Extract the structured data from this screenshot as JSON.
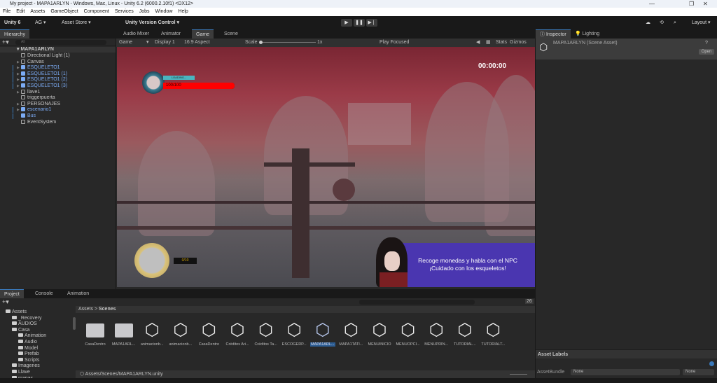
{
  "window": {
    "title": "My project - MAPA1ARLYN - Windows, Mac, Linux - Unity 6.2 (6000.2.10f1) <DX12>",
    "minimize": "—",
    "maximize": "❐",
    "close": "✕"
  },
  "menu": [
    "File",
    "Edit",
    "Assets",
    "GameObject",
    "Component",
    "Services",
    "Jobs",
    "Window",
    "Help"
  ],
  "toolbar": {
    "unity": "Unity 6",
    "account": "AG ▾",
    "asset_store": "Asset Store ▾",
    "version_control": "Unity Version Control ▾",
    "play": "▶",
    "pause": "❚❚",
    "step": "▶❘",
    "layout": "Layout ▾"
  },
  "hierarchy": {
    "tab": "Hierarchy",
    "search_placeholder": "All",
    "scene": "MAPA1ARLYN",
    "items": [
      {
        "label": "Directional Light (1)",
        "blue": false,
        "arrow": false
      },
      {
        "label": "Canvas",
        "blue": false,
        "arrow": true
      },
      {
        "label": "ESQUELETO1",
        "blue": true,
        "arrow": true
      },
      {
        "label": "ESQUELETO1 (1)",
        "blue": true,
        "arrow": true
      },
      {
        "label": "ESQUELETO1 (2)",
        "blue": true,
        "arrow": true
      },
      {
        "label": "ESQUELETO1 (3)",
        "blue": true,
        "arrow": true
      },
      {
        "label": "llave1",
        "blue": false,
        "arrow": true
      },
      {
        "label": "triggerpuerta",
        "blue": false,
        "arrow": false
      },
      {
        "label": "PERSONAJES",
        "blue": false,
        "arrow": true
      },
      {
        "label": "escenario1",
        "blue": true,
        "arrow": true
      },
      {
        "label": "Bus",
        "blue": true,
        "arrow": false
      },
      {
        "label": "EventSystem",
        "blue": false,
        "arrow": false
      }
    ]
  },
  "center_tabs": [
    "Audio Mixer",
    "Animator",
    "Game",
    "Scene"
  ],
  "game_toolbar": {
    "view": "Game",
    "display": "Display 1",
    "aspect": "16:9 Aspect",
    "scale_label": "Scale",
    "scale_value": "1x",
    "play_mode": "Play Focused",
    "stats": "Stats",
    "gizmos": "Gizmos"
  },
  "game": {
    "timer": "00:00:00",
    "health_label": "LOADING...",
    "health": "100/100",
    "health_fraction": 1.0,
    "coins": "0/10",
    "dialog_line1": "Recoge monedas y habla con el NPC",
    "dialog_line2": "¡Cuidado con los esqueletos!",
    "colors": {
      "health": "#ff0000",
      "dialog": "#4a36b0"
    }
  },
  "inspector": {
    "tabs": [
      "Inspector",
      "Lighting"
    ],
    "asset": "MAPA1ARLYN (Scene Asset)",
    "open": "Open",
    "labels": "Asset Labels",
    "bundle_label": "AssetBundle",
    "bundle": "None",
    "variant": "None"
  },
  "project": {
    "tabs": [
      "Project",
      "Console",
      "Animation"
    ],
    "tree": [
      {
        "label": "Assets",
        "indent": 0
      },
      {
        "label": "_Recovery",
        "indent": 1
      },
      {
        "label": "AUDIOS",
        "indent": 1
      },
      {
        "label": "Casa",
        "indent": 1
      },
      {
        "label": "Animation",
        "indent": 2
      },
      {
        "label": "Audio",
        "indent": 2
      },
      {
        "label": "Model",
        "indent": 2
      },
      {
        "label": "Prefab",
        "indent": 2
      },
      {
        "label": "Scripts",
        "indent": 2
      },
      {
        "label": "Imagenes",
        "indent": 1
      },
      {
        "label": "Llave",
        "indent": 1
      },
      {
        "label": "mapas",
        "indent": 1
      }
    ],
    "breadcrumb": [
      "Assets",
      "Scenes"
    ],
    "count": "26",
    "assets": [
      {
        "label": "CasaDentro",
        "type": "folder"
      },
      {
        "label": "MAPA1ARL...",
        "type": "folder"
      },
      {
        "label": "animacionb...",
        "type": "scene"
      },
      {
        "label": "animacionb...",
        "type": "scene"
      },
      {
        "label": "CasaDentro",
        "type": "scene"
      },
      {
        "label": "Créditos Ari...",
        "type": "scene"
      },
      {
        "label": "Créditos Ta...",
        "type": "scene"
      },
      {
        "label": "ESCOGERP...",
        "type": "scene"
      },
      {
        "label": "MAPA1ARL...",
        "type": "scene",
        "selected": true
      },
      {
        "label": "MAPA1TATI...",
        "type": "scene"
      },
      {
        "label": "MENUINICIO",
        "type": "scene"
      },
      {
        "label": "MENUOPCI...",
        "type": "scene"
      },
      {
        "label": "MENUPRIN...",
        "type": "scene"
      },
      {
        "label": "TUTORIAL...",
        "type": "scene"
      },
      {
        "label": "TUTORIALT...",
        "type": "scene"
      }
    ],
    "path": "Assets/Scenes/MAPA1ARLYN.unity"
  }
}
